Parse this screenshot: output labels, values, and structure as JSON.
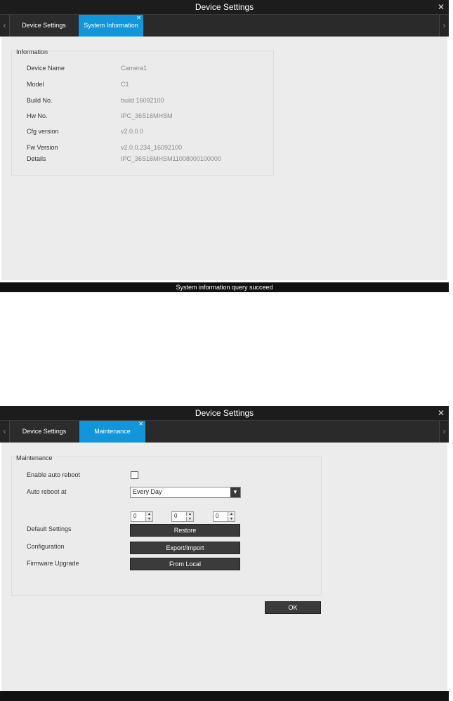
{
  "window1": {
    "title": "Device Settings",
    "tabs": [
      {
        "label": "Device Settings"
      },
      {
        "label": "System Information"
      }
    ],
    "group_title": "Information",
    "fields": [
      {
        "label": "Device Name",
        "value": "Camera1"
      },
      {
        "label": "Model",
        "value": "C1"
      },
      {
        "label": "Build No.",
        "value": "build 16092100"
      },
      {
        "label": "Hw No.",
        "value": "IPC_36S16MHSM"
      },
      {
        "label": "Cfg version",
        "value": "v2.0.0.0"
      },
      {
        "label": "Fw Version",
        "value": "v2.0.0.234_16092100"
      },
      {
        "label": "Details",
        "value": "IPC_36S16MHSM11008000100000"
      }
    ],
    "status": "System information query succeed"
  },
  "window2": {
    "title": "Device Settings",
    "tabs": [
      {
        "label": "Device Settings"
      },
      {
        "label": "Maintenance"
      }
    ],
    "group_title": "Maintenance",
    "enable_auto_reboot": {
      "label": "Enable auto reboot",
      "checked": false
    },
    "auto_reboot_at": {
      "label": "Auto reboot at",
      "value": "Every Day"
    },
    "time_spinners": [
      "0",
      "0",
      "0"
    ],
    "default_settings": {
      "label": "Default Settings",
      "button": "Restore"
    },
    "configuration": {
      "label": "Configuration",
      "button": "Export/Import"
    },
    "firmware_upgrade": {
      "label": "Firmware Upgrade",
      "button": "From Local"
    },
    "ok_button": "OK"
  },
  "icons": {
    "close": "close-icon",
    "tab_close": "tab-close-icon",
    "nav_left": "chevron-left-icon",
    "nav_right": "chevron-right-icon",
    "dropdown": "dropdown-arrow-icon",
    "spin_up": "spin-up-icon",
    "spin_down": "spin-down-icon"
  },
  "colors": {
    "title_bar": "#1c1c1c",
    "tab_active": "#1296db",
    "content_bg": "#ececec",
    "button_dark": "#3b3b3b"
  }
}
